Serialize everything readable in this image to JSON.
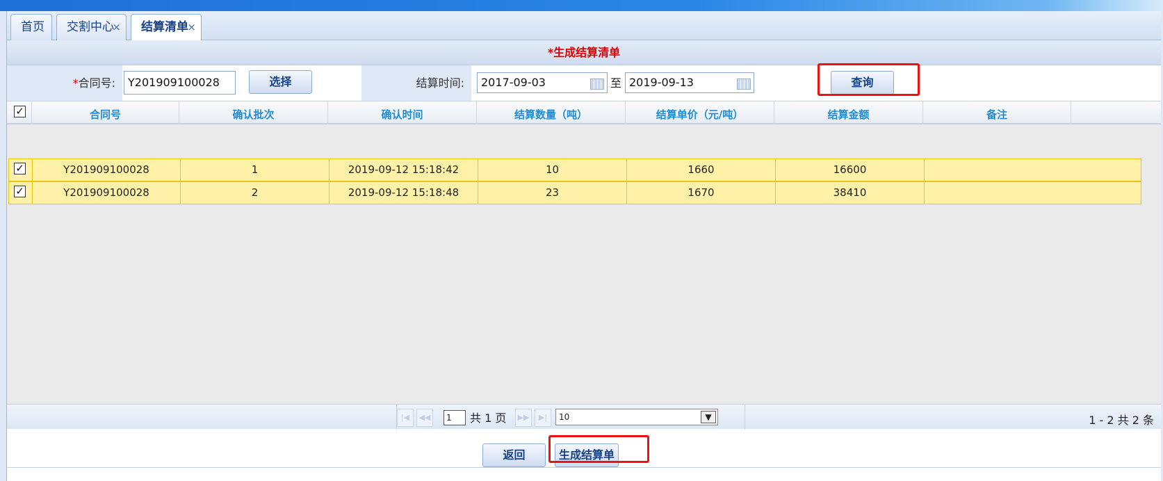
{
  "tabs": [
    {
      "label": "首页",
      "closable": false,
      "active": false
    },
    {
      "label": "交割中心",
      "closable": true,
      "active": false
    },
    {
      "label": "结算清单",
      "closable": true,
      "active": true
    }
  ],
  "close_glyph": "×",
  "section_title": "*生成结算清单",
  "form": {
    "contract_required_mark": "*",
    "contract_label": "合同号:",
    "contract_value": "Y201909100028",
    "select_button": "选择",
    "settle_time_label": "结算时间:",
    "date_from": "2017-09-03",
    "date_sep": "至",
    "date_to": "2019-09-13",
    "query_button": "查询"
  },
  "grid": {
    "columns": [
      "合同号",
      "确认批次",
      "确认时间",
      "结算数量（吨）",
      "结算单价（元/吨）",
      "结算金额",
      "备注"
    ],
    "rows": [
      {
        "checked": true,
        "contract": "Y201909100028",
        "batch": "1",
        "time": "2019-09-12 15:18:42",
        "qty": "10",
        "price": "1660",
        "amount": "16600",
        "remark": ""
      },
      {
        "checked": true,
        "contract": "Y201909100028",
        "batch": "2",
        "time": "2019-09-12 15:18:48",
        "qty": "23",
        "price": "1670",
        "amount": "38410",
        "remark": ""
      }
    ]
  },
  "pager": {
    "current_page": "1",
    "total_pages_text": "共 1 页",
    "page_size": "10",
    "summary": "1 - 2    共 2 条"
  },
  "footer": {
    "back_button": "返回",
    "generate_button": "生成结算单"
  },
  "colors": {
    "highlight": "#ee1111",
    "row_selected": "#fff1a8",
    "header_text": "#1f8dd6"
  }
}
